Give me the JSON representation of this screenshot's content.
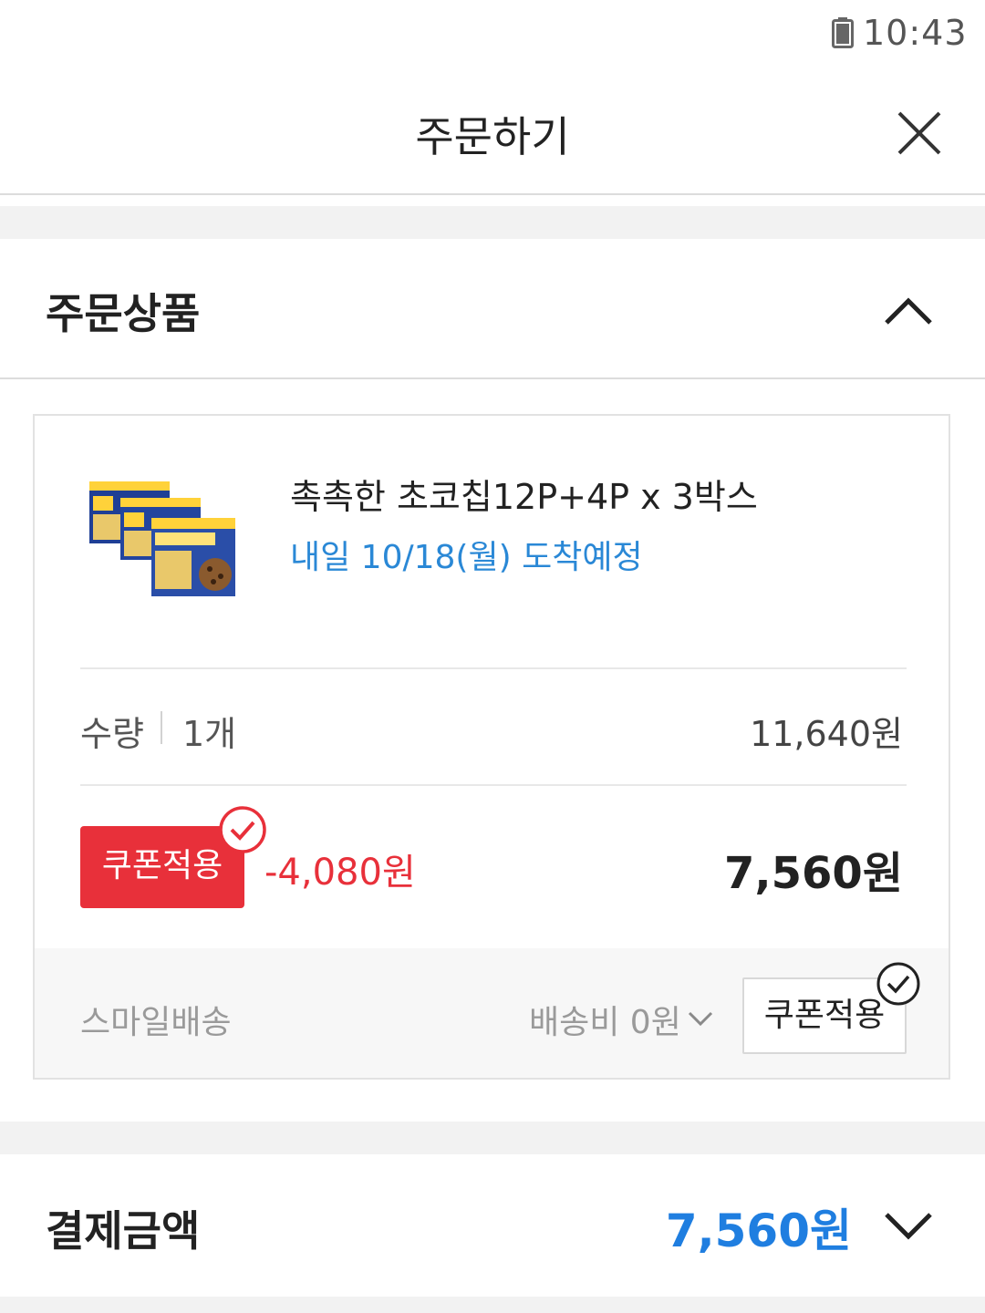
{
  "status_bar": {
    "time": "10:43"
  },
  "header": {
    "title": "주문하기",
    "close_icon": "close-icon"
  },
  "order_section": {
    "title": "주문상품",
    "toggle_icon": "chevron-up-icon",
    "item": {
      "name": "촉촉한 초코칩12P+4P x 3박스",
      "delivery": "내일 10/18(월) 도착예정",
      "quantity_label": "수량",
      "quantity_value": "1개",
      "original_price": "11,640원",
      "coupon_button_label": "쿠폰적용",
      "discount": "-4,080원",
      "final_price": "7,560원"
    },
    "shipping": {
      "type": "스마일배송",
      "fee": "배송비 0원",
      "coupon_button_label": "쿠폰적용"
    }
  },
  "payment_section": {
    "title": "결제금액",
    "amount": "7,560원",
    "toggle_icon": "chevron-down-icon"
  },
  "colors": {
    "accent_red": "#e8303a",
    "accent_blue": "#1f7ee0",
    "delivery_blue": "#2a88d6"
  }
}
